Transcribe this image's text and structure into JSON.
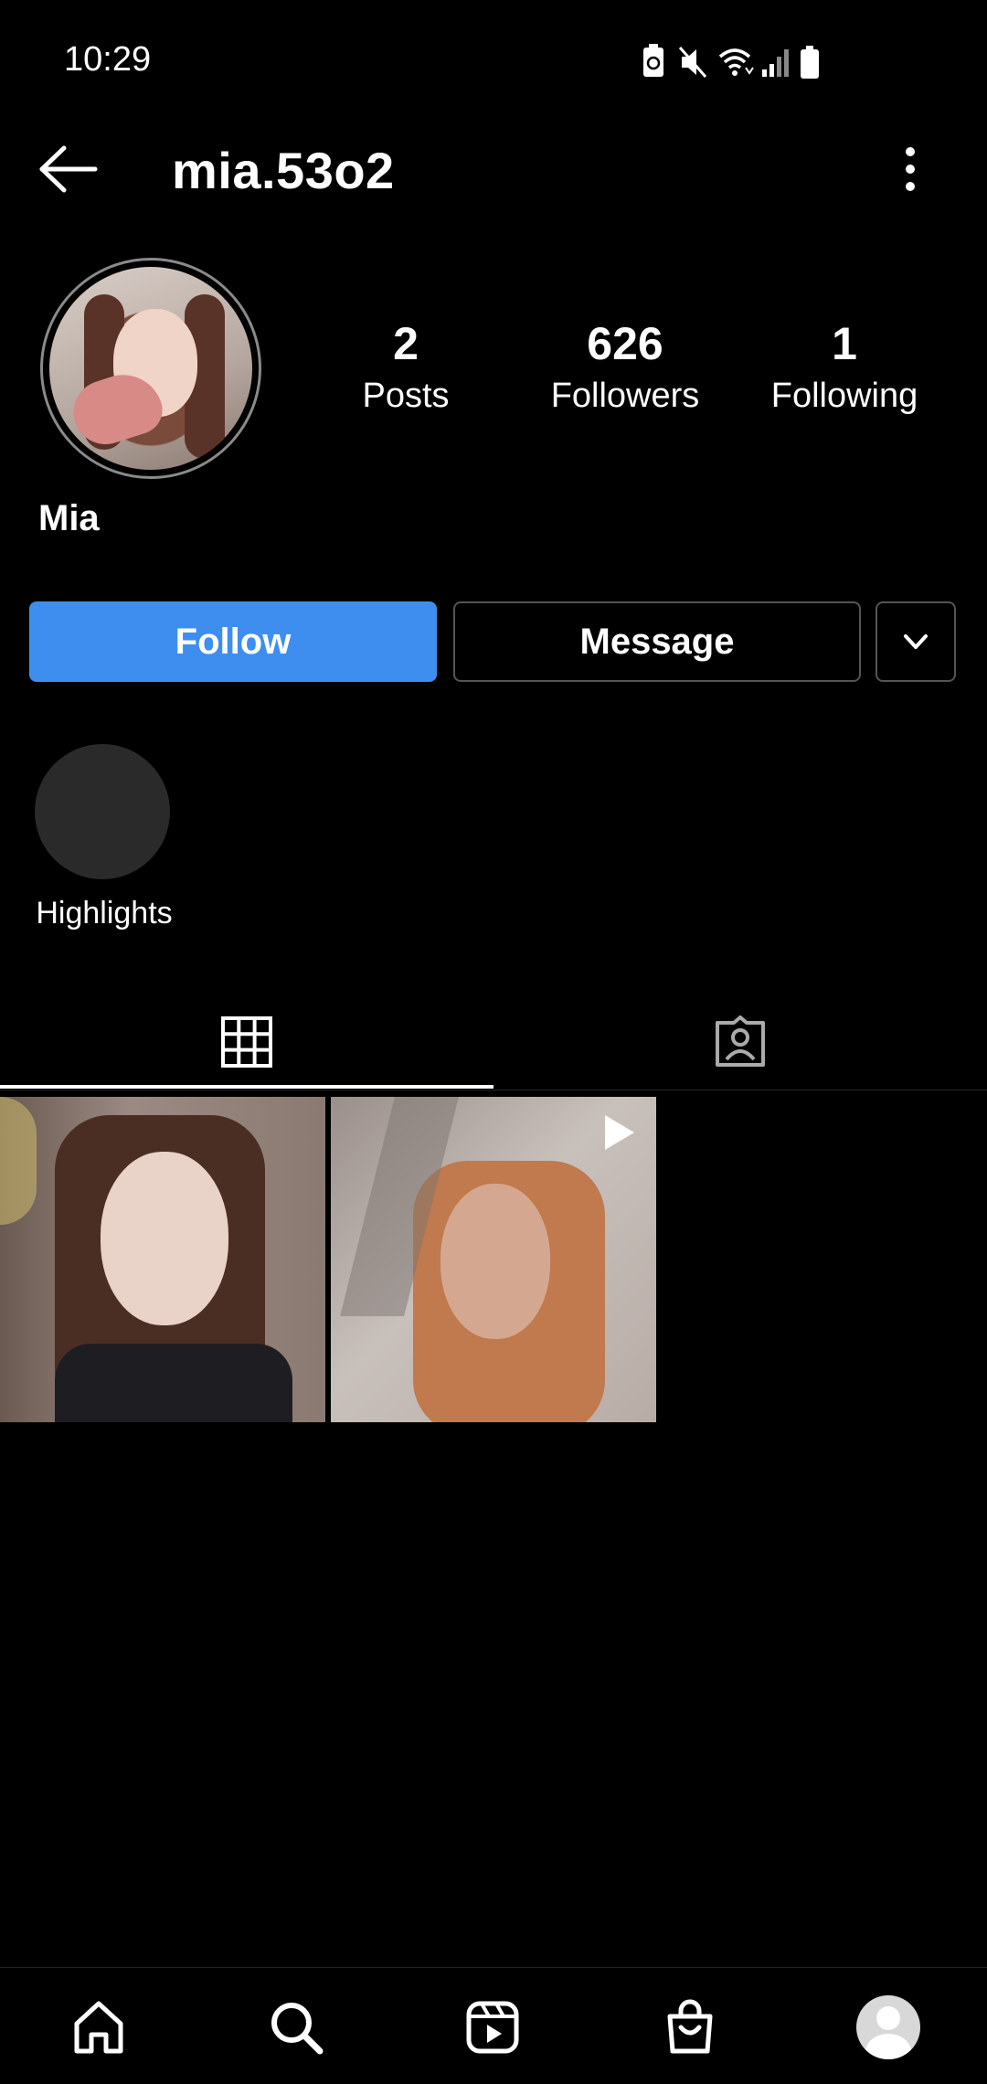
{
  "status_bar": {
    "time": "10:29",
    "icons": [
      "battery-saver-icon",
      "mute-icon",
      "wifi-icon",
      "signal-icon",
      "battery-icon"
    ]
  },
  "header": {
    "username": "mia.53o2",
    "back_icon": "arrow-left-icon",
    "menu_icon": "more-vertical-icon"
  },
  "profile": {
    "full_name": "Mia",
    "stats": [
      {
        "value": "2",
        "label": "Posts"
      },
      {
        "value": "626",
        "label": "Followers"
      },
      {
        "value": "1",
        "label": "Following"
      }
    ]
  },
  "actions": {
    "follow_label": "Follow",
    "message_label": "Message",
    "dropdown_icon": "chevron-down-icon"
  },
  "highlights": {
    "label": "Highlights"
  },
  "tabs": [
    {
      "name": "posts-grid",
      "icon": "grid-icon",
      "active": true
    },
    {
      "name": "tagged",
      "icon": "tagged-person-icon",
      "active": false
    }
  ],
  "posts": [
    {
      "type": "photo"
    },
    {
      "type": "video",
      "icon": "play-icon"
    }
  ],
  "bottom_nav": [
    {
      "name": "home",
      "icon": "home-icon"
    },
    {
      "name": "search",
      "icon": "search-icon"
    },
    {
      "name": "reels",
      "icon": "reels-icon"
    },
    {
      "name": "shop",
      "icon": "shopping-bag-icon"
    },
    {
      "name": "profile",
      "icon": "profile-avatar-icon"
    }
  ],
  "colors": {
    "background": "#000000",
    "follow_button": "#3e8ef0",
    "text": "#ffffff",
    "border": "#555555"
  }
}
